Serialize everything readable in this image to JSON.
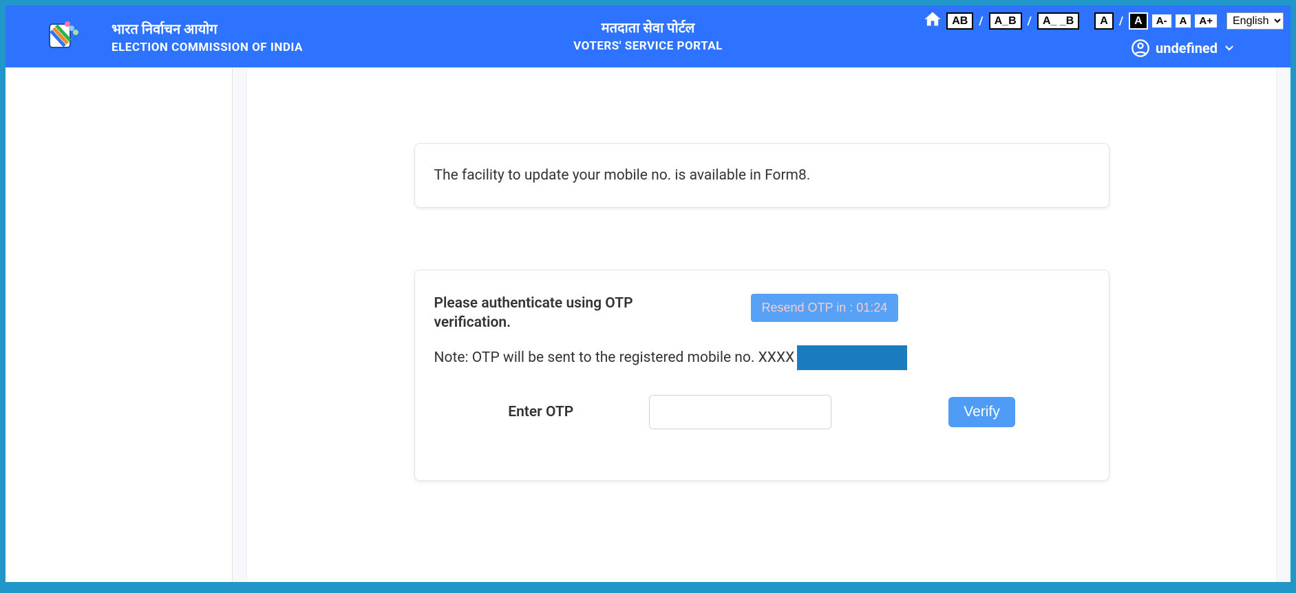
{
  "header": {
    "left_hi": "भारत निर्वाचन आयोग",
    "left_en": "ELECTION COMMISSION OF INDIA",
    "center_hi": "मतदाता सेवा पोर्टल",
    "center_en": "VOTERS' SERVICE PORTAL"
  },
  "controls": {
    "spacing1": "AB",
    "spacing2": "A_B",
    "spacing3": "A_ _B",
    "contrast_normal": "A",
    "contrast_inverse": "A",
    "size_minus": "A-",
    "size_normal": "A",
    "size_plus": "A+",
    "language_selected": "English"
  },
  "user": {
    "name": "undefined"
  },
  "card_note": {
    "text": "The facility to update your mobile no. is available in Form8."
  },
  "otp": {
    "instruction": "Please authenticate using OTP verification.",
    "resend_prefix": "Resend OTP in : ",
    "resend_time": "01:24",
    "note_prefix": "Note: OTP will be sent to the registered mobile no. XXXX",
    "enter_label": "Enter OTP",
    "verify_label": "Verify"
  }
}
